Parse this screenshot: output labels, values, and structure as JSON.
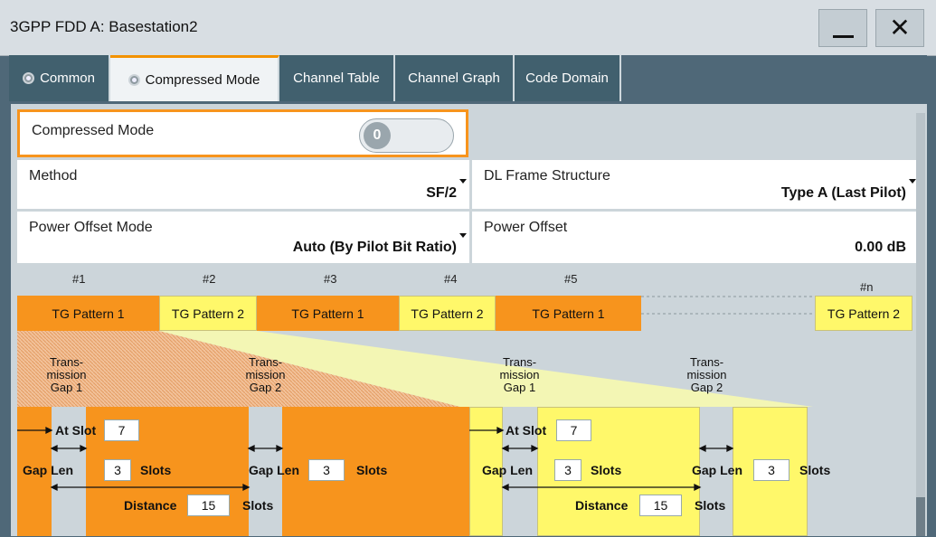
{
  "window": {
    "title": "3GPP FDD A: Basestation2"
  },
  "tabs": [
    {
      "label": "Common",
      "has_dot": true,
      "active": false
    },
    {
      "label": "Compressed Mode",
      "has_dot": true,
      "active": true
    },
    {
      "label": "Channel Table",
      "has_dot": false,
      "active": false
    },
    {
      "label": "Channel Graph",
      "has_dot": false,
      "active": false
    },
    {
      "label": "Code Domain",
      "has_dot": false,
      "active": false
    }
  ],
  "compressed_mode": {
    "label": "Compressed Mode",
    "toggle_state": "0"
  },
  "method": {
    "label": "Method",
    "value": "SF/2"
  },
  "dl_frame_structure": {
    "label": "DL Frame Structure",
    "value": "Type A (Last Pilot)"
  },
  "power_offset_mode": {
    "label": "Power Offset Mode",
    "value": "Auto (By Pilot Bit Ratio)"
  },
  "power_offset": {
    "label": "Power Offset",
    "value": "0.00 dB"
  },
  "diagram": {
    "numbers": [
      "#1",
      "#2",
      "#3",
      "#4",
      "#5",
      "#n"
    ],
    "patterns": [
      "TG Pattern 1",
      "TG Pattern 2",
      "TG Pattern 1",
      "TG Pattern 2",
      "TG Pattern 1",
      "TG Pattern 2"
    ],
    "gap_labels": [
      "Trans-\nmission\nGap 1",
      "Trans-\nmission\nGap 2",
      "Trans-\nmission\nGap 1",
      "Trans-\nmission\nGap 2"
    ],
    "p1": {
      "at_slot_label": "At Slot",
      "at_slot": "7",
      "gap_len_label": "Gap Len",
      "gap_len": "3",
      "slots_label": "Slots",
      "distance_label": "Distance",
      "distance": "15",
      "gap2_len": "3"
    },
    "p2": {
      "at_slot_label": "At Slot",
      "at_slot": "7",
      "gap_len_label": "Gap Len",
      "gap_len": "3",
      "slots_label": "Slots",
      "distance_label": "Distance",
      "distance": "15",
      "gap2_len": "3"
    }
  },
  "colors": {
    "orange": "#f7941d",
    "yellow": "#fff86a",
    "accent": "#f39200"
  }
}
